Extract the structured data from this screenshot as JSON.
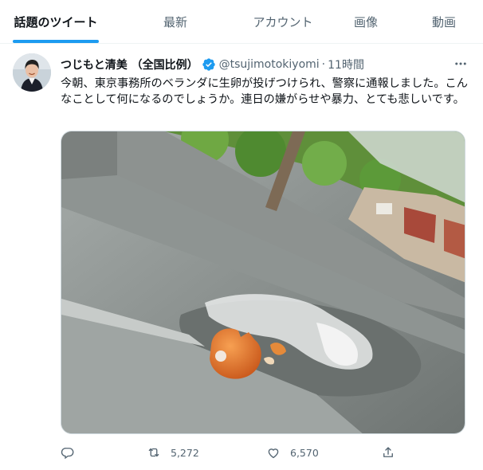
{
  "tabs": [
    {
      "label": "話題のツイート",
      "active": true
    },
    {
      "label": "最新",
      "active": false
    },
    {
      "label": "アカウント",
      "active": false
    },
    {
      "label": "画像",
      "active": false
    },
    {
      "label": "動画",
      "active": false
    }
  ],
  "tweet": {
    "display_name": "つじもと清美 （全国比例）",
    "handle": "@tsujimotokiyomi",
    "separator": "·",
    "time": "11時間",
    "text": "今朝、東京事務所のベランダに生卵が投げつけられ、警察に通報しました。こんなことして何になるのでしょうか。連日の嫌がらせや暴力、とても悲しいです。",
    "verified_icon": "verified-badge-icon",
    "media_icon": "photo-broken-egg-on-balcony",
    "actions": {
      "reply_count": "",
      "retweet_count": "5,272",
      "like_count": "6,570"
    }
  },
  "colors": {
    "accent": "#1d9bf0",
    "text_primary": "#0f1419",
    "text_secondary": "#536471",
    "border": "#eff3f4"
  }
}
